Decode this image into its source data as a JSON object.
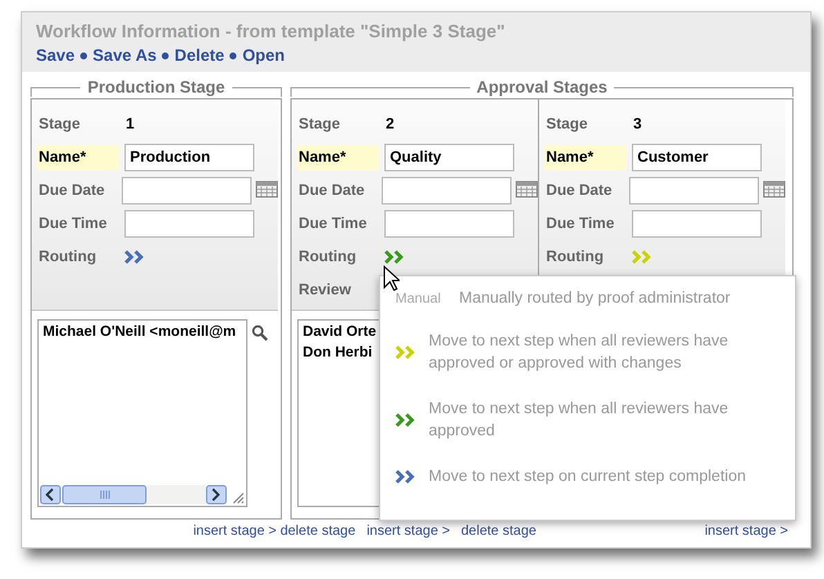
{
  "title": "Workflow Information - from template \"Simple 3 Stage\"",
  "actions": [
    "Save",
    "Save As",
    "Delete",
    "Open"
  ],
  "sections": [
    {
      "legend": "Production Stage",
      "stages": [
        {
          "stage_label": "Stage",
          "number": "1",
          "name_label": "Name*",
          "name": "Production",
          "due_date_label": "Due Date",
          "due_time_label": "Due Time",
          "routing": {
            "label": "Routing",
            "color": "#4a6fb5"
          },
          "reviewers": [
            "Michael O'Neill <moneill@m"
          ],
          "scrollbar": true,
          "links": [
            "insert stage >"
          ]
        }
      ]
    },
    {
      "legend": "Approval Stages",
      "stages": [
        {
          "stage_label": "Stage",
          "number": "2",
          "name_label": "Name*",
          "name": "Quality",
          "due_date_label": "Due Date",
          "due_time_label": "Due Time",
          "routing": {
            "label": "Routing",
            "color": "#3a9a1e"
          },
          "review_label": "Review",
          "reviewers": [
            "David Orte",
            "Don Herbi"
          ],
          "links": [
            "delete stage",
            "insert stage >",
            "delete stage"
          ]
        },
        {
          "stage_label": "Stage",
          "number": "3",
          "name_label": "Name*",
          "name": "Customer",
          "due_date_label": "Due Date",
          "due_time_label": "Due Time",
          "routing": {
            "label": "Routing",
            "color": "#c8d400"
          },
          "links": [
            "insert stage >"
          ]
        }
      ]
    }
  ],
  "routing_menu": [
    {
      "kind": "manual",
      "tag": "Manual",
      "text": "Manually routed by proof administrator"
    },
    {
      "kind": "icon",
      "color": "#c8d400",
      "text": "Move to next step when all reviewers have approved or approved with changes"
    },
    {
      "kind": "icon",
      "color": "#3a9a1e",
      "text": "Move to next step when all reviewers have approved"
    },
    {
      "kind": "icon",
      "color": "#4a6fb5",
      "text": "Move to next step on current step completion"
    }
  ]
}
